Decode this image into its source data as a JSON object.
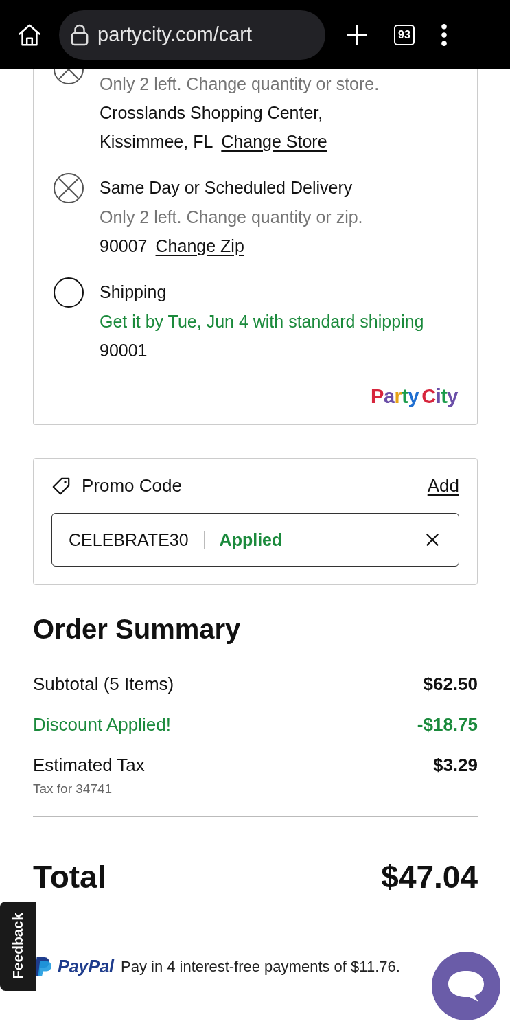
{
  "browser": {
    "url": "partycity.com/cart",
    "tab_count": "93"
  },
  "delivery_options": [
    {
      "available": false,
      "note": "Only 2 left. Change quantity or store.",
      "color": "#757575",
      "details": [
        "Crosslands Shopping Center,",
        "Kissimmee,  FL"
      ],
      "link": "Change Store"
    },
    {
      "available": false,
      "title": "Same Day or Scheduled Delivery",
      "note": "Only 2 left. Change quantity or zip.",
      "color": "#757575",
      "details": [
        "90007"
      ],
      "link": "Change Zip"
    },
    {
      "available": true,
      "title": "Shipping",
      "note": "Get it by Tue, Jun 4 with standard shipping",
      "color": "#1b8a3c",
      "details": [
        "90001"
      ]
    }
  ],
  "brand_logo": [
    "Party",
    "City"
  ],
  "promo": {
    "label": "Promo Code",
    "action": "Add",
    "code": "CELEBRATE30",
    "status": "Applied"
  },
  "summary": {
    "title": "Order Summary",
    "rows": [
      {
        "label": "Subtotal (5 Items)",
        "value": "$62.50",
        "color": "#111111"
      },
      {
        "label": "Discount Applied!",
        "value": "-$18.75",
        "color": "#1b8a3c"
      },
      {
        "label": "Estimated Tax",
        "value": "$3.29",
        "color": "#111111",
        "sublabel": "Tax for 34741"
      }
    ],
    "total_label": "Total",
    "total_value": "$47.04"
  },
  "paypal": {
    "brand": "PayPal",
    "text": "Pay in 4 interest-free payments of $11.76."
  },
  "feedback_tab": "Feedback"
}
